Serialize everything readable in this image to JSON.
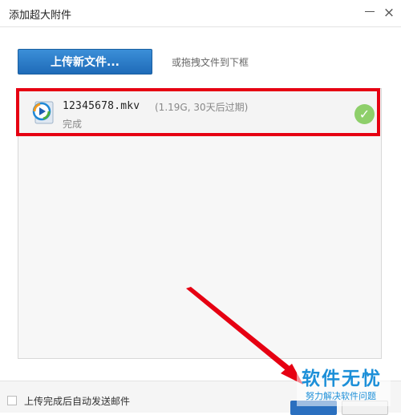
{
  "window": {
    "title": "添加超大附件",
    "minimize_icon": "minimize-icon",
    "close_icon": "×"
  },
  "upload": {
    "button_label": "上传新文件...",
    "drag_hint": "或拖拽文件到下框"
  },
  "files": [
    {
      "name": "12345678.mkv",
      "meta": "(1.19G, 30天后过期)",
      "status": "完成",
      "icon": "video-file-icon",
      "status_icon": "✓"
    }
  ],
  "footer": {
    "auto_send_label": "上传完成后自动发送邮件",
    "auto_send_checked": false
  },
  "watermark": {
    "title": "软件无忧",
    "subtitle": "努力解决软件问题"
  },
  "colors": {
    "highlight_red": "#e60012",
    "primary_blue": "#1f6bb8",
    "success_green": "#8ecf6a",
    "watermark_blue": "#1c8fd8"
  }
}
